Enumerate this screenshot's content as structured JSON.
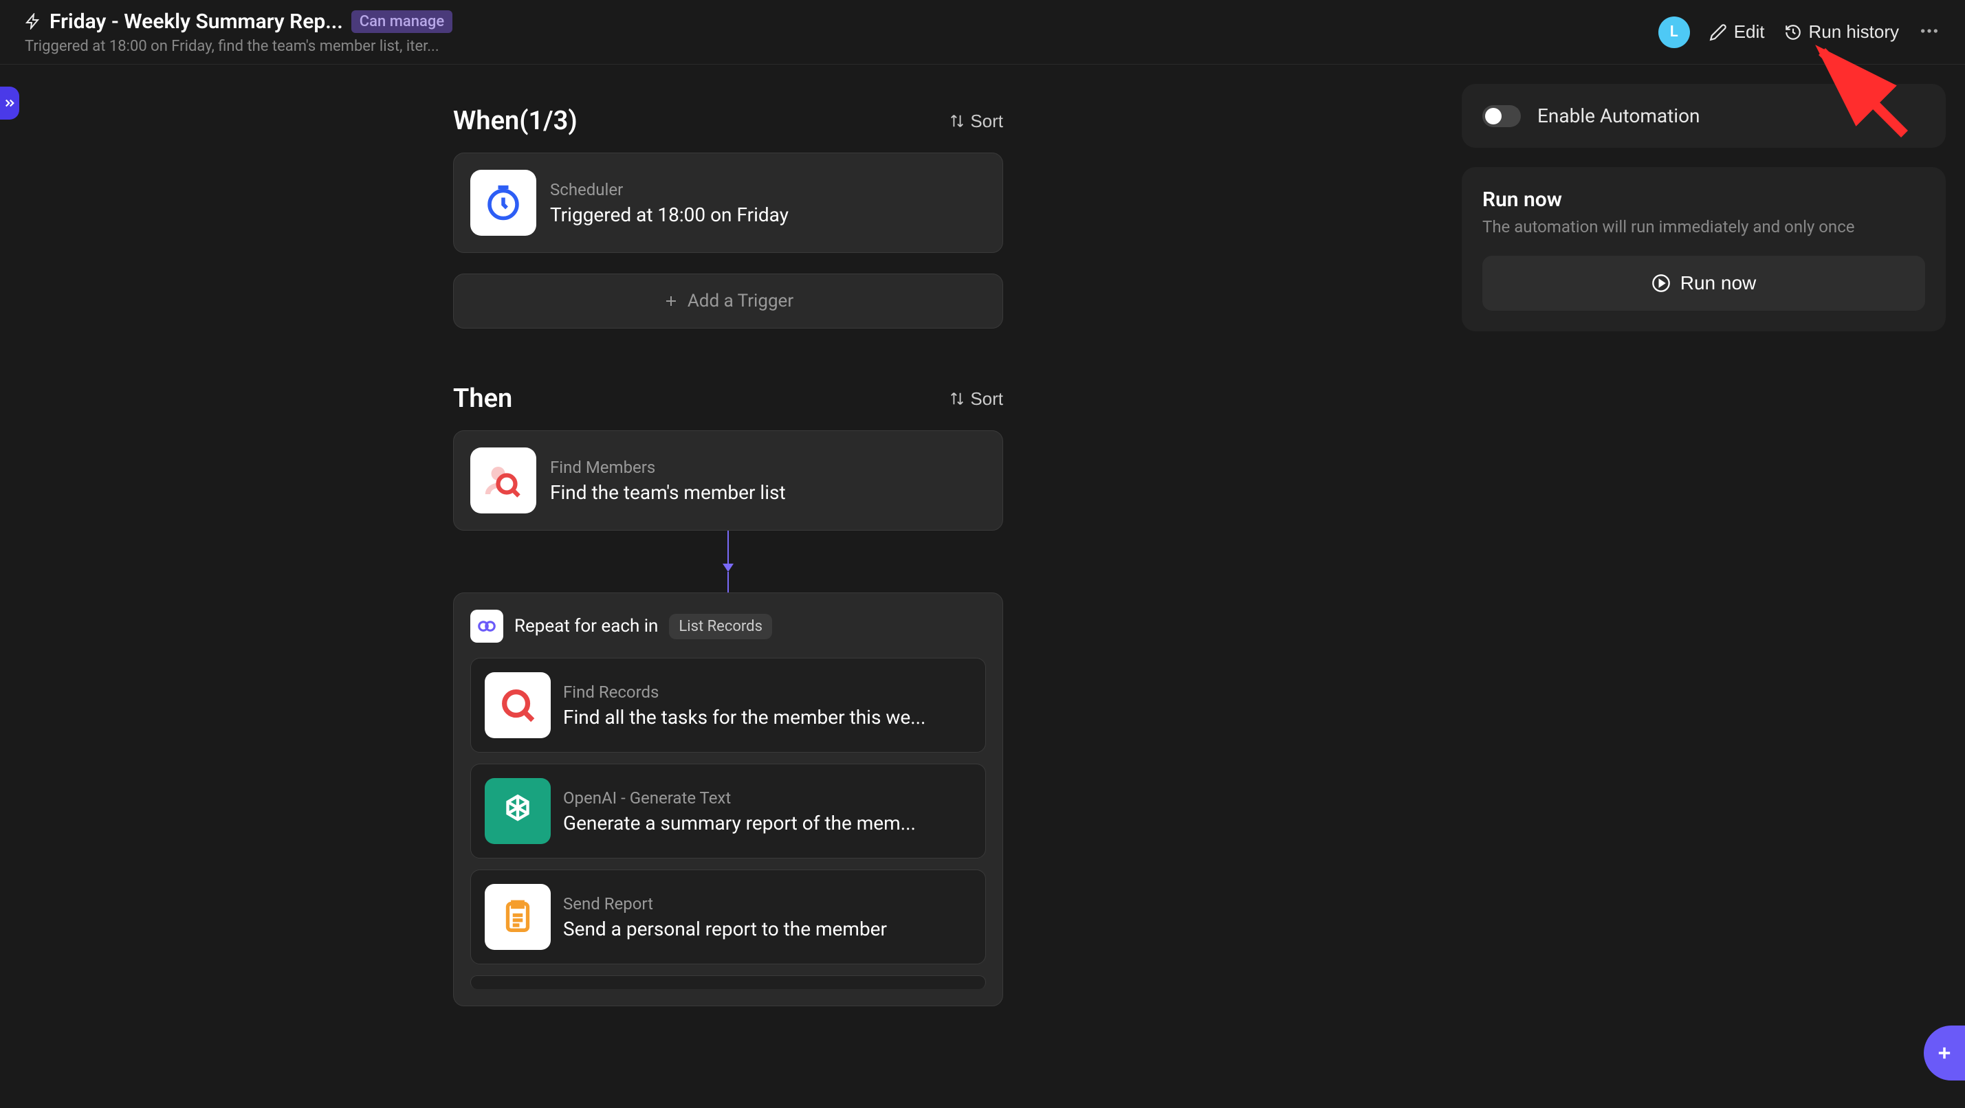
{
  "header": {
    "title": "Friday - Weekly Summary Rep...",
    "badge": "Can manage",
    "subtitle": "Triggered at 18:00 on Friday, find the team's member list, iter...",
    "avatar_letter": "L",
    "edit_label": "Edit",
    "run_history_label": "Run history"
  },
  "when": {
    "title": "When(1/3)",
    "sort_label": "Sort",
    "trigger": {
      "label": "Scheduler",
      "desc": "Triggered at 18:00 on Friday"
    },
    "add_trigger_label": "Add a Trigger"
  },
  "then": {
    "title": "Then",
    "sort_label": "Sort",
    "find_members": {
      "label": "Find Members",
      "desc": "Find the team's member list"
    },
    "loop": {
      "label": "Repeat for each in",
      "pill": "List Records",
      "steps": [
        {
          "label": "Find Records",
          "desc": "Find all the tasks for the member this we..."
        },
        {
          "label": "OpenAI - Generate Text",
          "desc": "Generate a summary report of the mem..."
        },
        {
          "label": "Send Report",
          "desc": "Send a personal report to the member"
        }
      ]
    }
  },
  "side": {
    "enable_label": "Enable Automation",
    "run_title": "Run now",
    "run_desc": "The automation will run immediately and only once",
    "run_button": "Run now"
  }
}
